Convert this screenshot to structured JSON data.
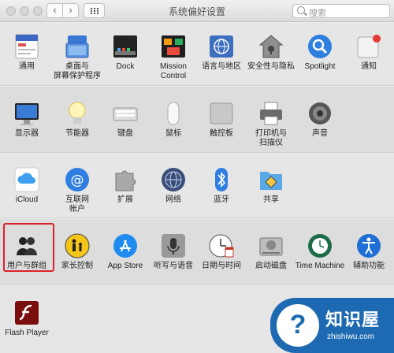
{
  "window": {
    "title": "系统偏好设置"
  },
  "toolbar": {
    "back_glyph": "‹",
    "forward_glyph": "›"
  },
  "search": {
    "placeholder": "搜索"
  },
  "rows": [
    [
      {
        "label": "通用",
        "icon": "general-icon"
      },
      {
        "label": "桌面与\n屏幕保护程序",
        "icon": "desktop-screensaver-icon"
      },
      {
        "label": "Dock",
        "icon": "dock-icon"
      },
      {
        "label": "Mission\nControl",
        "icon": "mission-control-icon"
      },
      {
        "label": "语言与地区",
        "icon": "language-region-icon"
      },
      {
        "label": "安全性与隐私",
        "icon": "security-privacy-icon"
      },
      {
        "label": "Spotlight",
        "icon": "spotlight-icon"
      },
      {
        "label": "通知",
        "icon": "notifications-icon"
      }
    ],
    [
      {
        "label": "显示器",
        "icon": "displays-icon"
      },
      {
        "label": "节能器",
        "icon": "energy-saver-icon"
      },
      {
        "label": "键盘",
        "icon": "keyboard-icon"
      },
      {
        "label": "鼠标",
        "icon": "mouse-icon"
      },
      {
        "label": "触控板",
        "icon": "trackpad-icon"
      },
      {
        "label": "打印机与\n扫描仪",
        "icon": "printers-scanners-icon"
      },
      {
        "label": "声音",
        "icon": "sound-icon"
      }
    ],
    [
      {
        "label": "iCloud",
        "icon": "icloud-icon"
      },
      {
        "label": "互联网\n帐户",
        "icon": "internet-accounts-icon"
      },
      {
        "label": "扩展",
        "icon": "extensions-icon"
      },
      {
        "label": "网络",
        "icon": "network-icon"
      },
      {
        "label": "蓝牙",
        "icon": "bluetooth-icon"
      },
      {
        "label": "共享",
        "icon": "sharing-icon"
      }
    ],
    [
      {
        "label": "用户与群组",
        "icon": "users-groups-icon"
      },
      {
        "label": "家长控制",
        "icon": "parental-controls-icon"
      },
      {
        "label": "App Store",
        "icon": "app-store-icon"
      },
      {
        "label": "听写与语音",
        "icon": "dictation-speech-icon"
      },
      {
        "label": "日期与时间",
        "icon": "date-time-icon"
      },
      {
        "label": "启动磁盘",
        "icon": "startup-disk-icon"
      },
      {
        "label": "Time Machine",
        "icon": "time-machine-icon"
      },
      {
        "label": "辅助功能",
        "icon": "accessibility-icon"
      }
    ],
    [
      {
        "label": "Flash Player",
        "icon": "flash-player-icon"
      }
    ]
  ],
  "watermark": {
    "brand": "知识屋",
    "url": "zhishiwu.com",
    "logo_glyph": "?"
  }
}
